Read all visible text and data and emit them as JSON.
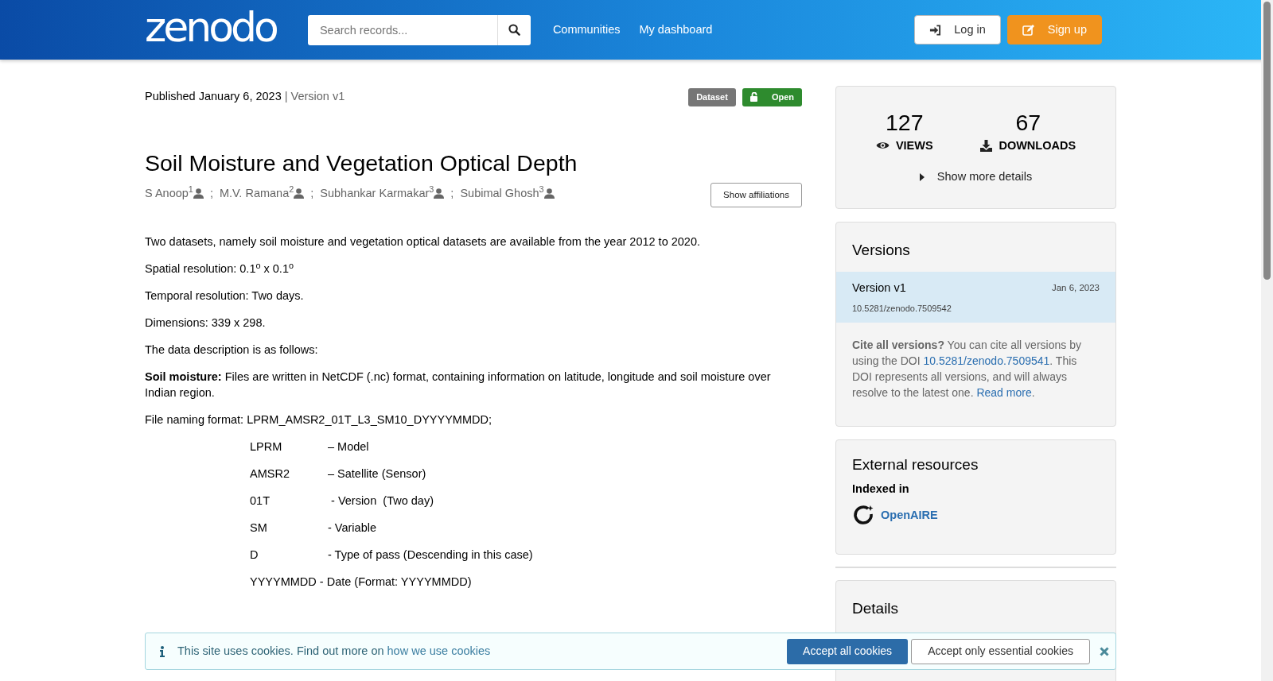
{
  "navbar": {
    "logo": "zenodo",
    "search": {
      "placeholder": "Search records..."
    },
    "links": [
      "Communities",
      "My dashboard"
    ],
    "buttons": [
      {
        "label": "Log in",
        "kind": "login"
      },
      {
        "label": "Sign up",
        "kind": "signup"
      }
    ]
  },
  "record": {
    "published": "Published January 6, 2023",
    "version": "| Version v1",
    "badges": [
      {
        "label": "Dataset",
        "kind": "type"
      },
      {
        "label": "Open",
        "kind": "access"
      }
    ],
    "title": "Soil Moisture and Vegetation Optical Depth",
    "creators": [
      {
        "name": "S Anoop",
        "affiliation": "1"
      },
      {
        "name": "M.V. Ramana",
        "affiliation": "2"
      },
      {
        "name": "Subhankar Karmakar",
        "affiliation": "3"
      },
      {
        "name": "Subimal Ghosh",
        "affiliation": "3"
      }
    ],
    "separator": ";",
    "show_affiliations": "Show affiliations",
    "description": [
      "Two datasets, namely soil moisture and vegetation optical datasets are available from the year 2012 to 2020.",
      "Spatial resolution: 0.1$^{o}$ x 0.1$^{o}$",
      "Temporal resolution: Two days.",
      "Dimensions: 339 x 298.",
      "The data description is as follows:",
      "**Soil moisture:** Files are written in NetCDF (.nc) format, containing information on latitude, longitude and soil moisture over Indian region.",
      "File naming format:  LPRM_AMSR2_01T_L3_SM10_DYYYYMMDD;"
    ],
    "naming": [
      {
        "kind": "pair",
        "code": "LPRM",
        "meaning": "– Model"
      },
      {
        "kind": "pair",
        "code": "AMSR2",
        "meaning": "– Satellite (Sensor)"
      },
      {
        "kind": "pair",
        "code": "01T",
        "meaning": " - Version  (Two day)"
      },
      {
        "kind": "pair",
        "code": "SM",
        "meaning": "- Variable"
      },
      {
        "kind": "pair",
        "code": "D",
        "meaning": "- Type of pass (Descending in this case)"
      },
      {
        "kind": "line",
        "text": "YYYYMMDD - Date (Format: YYYYMMDD)"
      }
    ]
  },
  "sidebar": {
    "stats": [
      {
        "value": "127",
        "label": "VIEWS",
        "kind": "views"
      },
      {
        "value": "67",
        "label": "DOWNLOADS",
        "kind": "downloads"
      }
    ],
    "show_more": "Show more details",
    "versions": {
      "title": "Versions",
      "items": [
        {
          "label": "Version v1",
          "date": "Jan 6, 2023",
          "doi": "10.5281/zenodo.7509542",
          "selected": true
        }
      ],
      "cite": [
        {
          "kind": "bold",
          "text": "Cite all versions?"
        },
        {
          "kind": "text",
          "text": " You can cite all versions by using the DOI "
        },
        {
          "kind": "link",
          "text": "10.5281/zenodo.7509541"
        },
        {
          "kind": "text",
          "text": ". This DOI represents all versions, and will always resolve to the latest one. "
        },
        {
          "kind": "link",
          "text": "Read more"
        },
        {
          "kind": "text",
          "text": "."
        }
      ]
    },
    "external": {
      "title": "External resources",
      "indexed_in": "Indexed in",
      "items": [
        "OpenAIRE"
      ]
    },
    "details": {
      "title": "Details"
    }
  },
  "cookie_banner": {
    "text": "This site uses cookies. Find out more on ",
    "link": "how we use cookies",
    "buttons": [
      {
        "label": "Accept all cookies",
        "kind": "primary"
      },
      {
        "label": "Accept only essential cookies",
        "kind": "secondary"
      }
    ]
  }
}
